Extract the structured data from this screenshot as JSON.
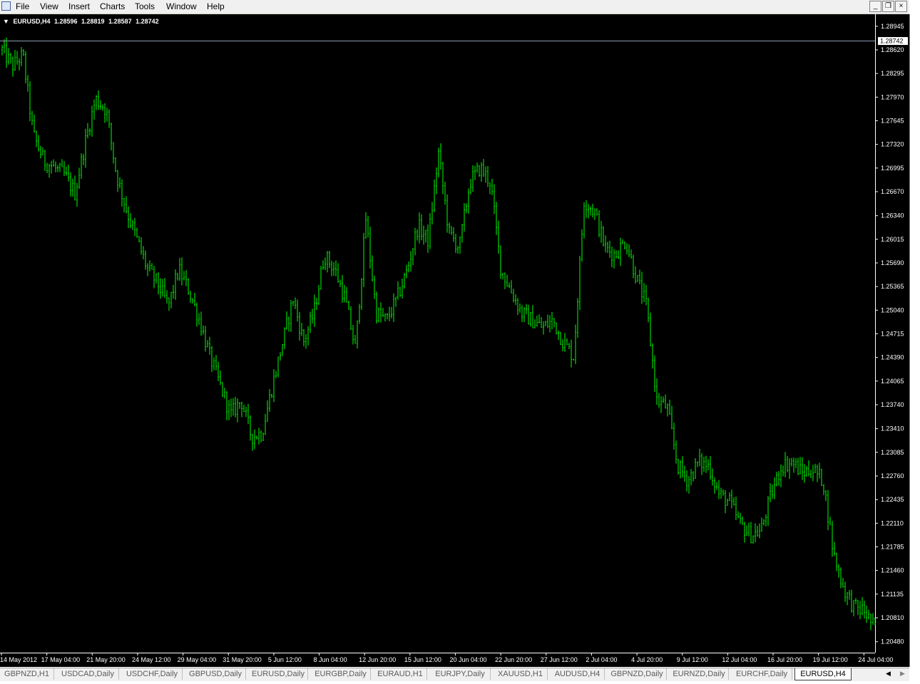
{
  "menu": {
    "items": [
      "File",
      "View",
      "Insert",
      "Charts",
      "Tools",
      "Window",
      "Help"
    ]
  },
  "window_controls": {
    "minimize": "_",
    "restore": "❐",
    "close": "×"
  },
  "chart_header": {
    "symbol": "EURUSD,H4",
    "open": "1.28596",
    "high": "1.28819",
    "low": "1.28587",
    "close": "1.28742"
  },
  "tabs": [
    {
      "label": "GBPNZD,H1",
      "active": false
    },
    {
      "label": "USDCAD,Daily",
      "active": false
    },
    {
      "label": "USDCHF,Daily",
      "active": false
    },
    {
      "label": "GBPUSD,Daily",
      "active": false
    },
    {
      "label": "EURUSD,Daily",
      "active": false
    },
    {
      "label": "EURGBP,Daily",
      "active": false
    },
    {
      "label": "EURAUD,H1",
      "active": false
    },
    {
      "label": "EURJPY,Daily",
      "active": false
    },
    {
      "label": "XAUUSD,H1",
      "active": false
    },
    {
      "label": "AUDUSD,H4",
      "active": false
    },
    {
      "label": "GBPNZD,Daily",
      "active": false
    },
    {
      "label": "EURNZD,Daily",
      "active": false
    },
    {
      "label": "EURCHF,Daily",
      "active": false
    },
    {
      "label": "EURUSD,H4",
      "active": true
    }
  ],
  "colors": {
    "chart_background": "#000000",
    "bar_color": "#00ff00",
    "axis_text": "#ffffff",
    "bid_line": "#8a9bb0"
  },
  "chart_data": {
    "type": "ohlc",
    "title": "EURUSD,H4",
    "current_price": "1.28742",
    "current_price_value": 1.28742,
    "ylim": [
      1.2033,
      1.2911
    ],
    "y_tick_labels": [
      "1.28945",
      "1.28620",
      "1.28295",
      "1.27970",
      "1.27645",
      "1.27320",
      "1.26995",
      "1.26670",
      "1.26340",
      "1.26015",
      "1.25690",
      "1.25365",
      "1.25040",
      "1.24715",
      "1.24390",
      "1.24065",
      "1.23740",
      "1.23410",
      "1.23085",
      "1.22760",
      "1.22435",
      "1.22110",
      "1.21785",
      "1.21460",
      "1.21135",
      "1.20810",
      "1.20480"
    ],
    "x_tick_labels": [
      "14 May 2012",
      "17 May 04:00",
      "21 May 20:00",
      "24 May 12:00",
      "29 May 04:00",
      "31 May 20:00",
      "5 Jun 12:00",
      "8 Jun 04:00",
      "12 Jun 20:00",
      "15 Jun 12:00",
      "20 Jun 04:00",
      "22 Jun 20:00",
      "27 Jun 12:00",
      "2 Jul 04:00",
      "4 Jul 20:00",
      "9 Jul 12:00",
      "12 Jul 04:00",
      "16 Jul 20:00",
      "19 Jul 12:00",
      "24 Jul 04:00"
    ],
    "close_path": [
      1.2862,
      1.284,
      1.2855,
      1.2745,
      1.271,
      1.27,
      1.269,
      1.2665,
      1.2735,
      1.2795,
      1.278,
      1.269,
      1.264,
      1.26,
      1.256,
      1.254,
      1.251,
      1.256,
      1.253,
      1.249,
      1.244,
      1.24,
      1.236,
      1.238,
      1.233,
      1.2335,
      1.24,
      1.246,
      1.252,
      1.246,
      1.25,
      1.258,
      1.256,
      1.252,
      1.245,
      1.263,
      1.25,
      1.249,
      1.252,
      1.256,
      1.262,
      1.26,
      1.272,
      1.261,
      1.259,
      1.268,
      1.27,
      1.268,
      1.256,
      1.253,
      1.25,
      1.249,
      1.248,
      1.249,
      1.246,
      1.244,
      1.2655,
      1.264,
      1.259,
      1.258,
      1.26,
      1.255,
      1.251,
      1.238,
      1.237,
      1.229,
      1.227,
      1.2295,
      1.229,
      1.225,
      1.224,
      1.221,
      1.2195,
      1.22,
      1.225,
      1.229,
      1.2295,
      1.228,
      1.2285,
      1.227,
      1.217,
      1.212,
      1.2095,
      1.209,
      1.2065
    ],
    "y_label": "",
    "x_label": "",
    "grid": false
  }
}
